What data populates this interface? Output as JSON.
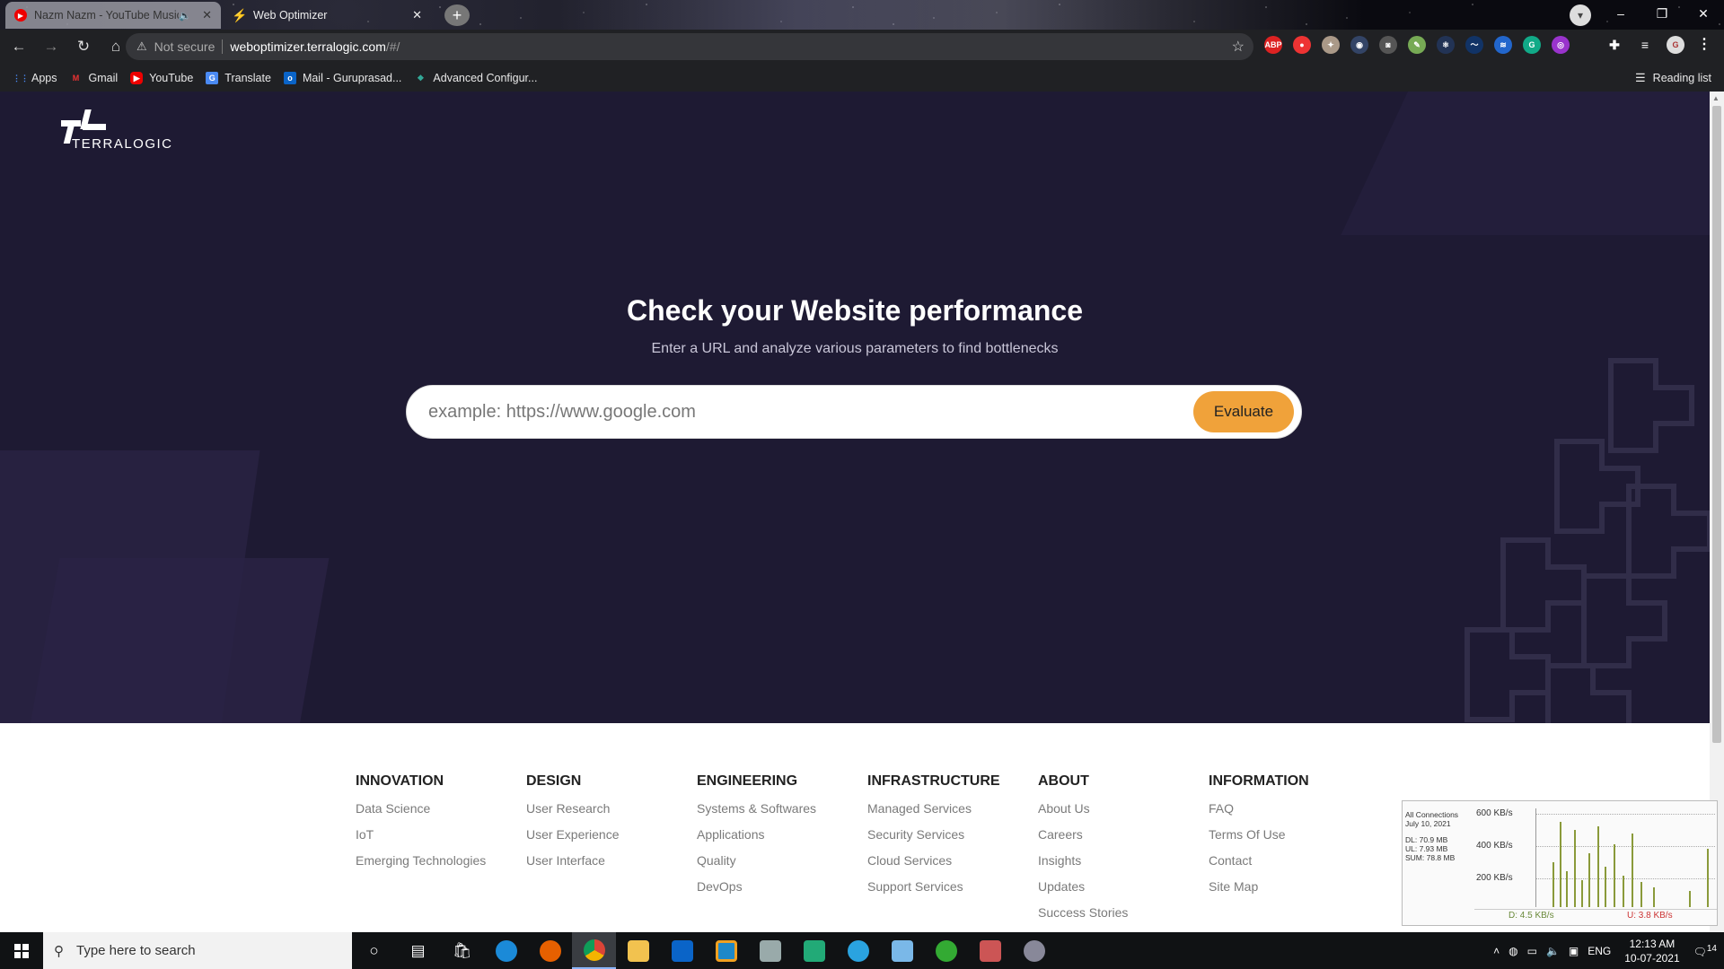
{
  "browser": {
    "tabs": [
      {
        "title": "Nazm Nazm - YouTube Music",
        "active": true
      },
      {
        "title": "Web Optimizer",
        "active": false
      }
    ],
    "omnibox": {
      "security": "Not secure",
      "host": "weboptimizer.terralogic.com",
      "path": "/#/"
    },
    "bookmarks": [
      {
        "label": "Apps"
      },
      {
        "label": "Gmail"
      },
      {
        "label": "YouTube"
      },
      {
        "label": "Translate"
      },
      {
        "label": "Mail - Guruprasad..."
      },
      {
        "label": "Advanced Configur..."
      }
    ],
    "reading_list": "Reading list",
    "extensions": [
      "ABP",
      "pocket",
      "puzzle",
      "camera",
      "pencil",
      "cube",
      "react",
      "wave",
      "stack",
      "G",
      "circle-purple"
    ]
  },
  "page": {
    "logo_text": "TERRALOGIC",
    "hero": {
      "title": "Check your Website performance",
      "subtitle": "Enter a URL and analyze various parameters to find bottlenecks",
      "search_placeholder": "example: https://www.google.com",
      "evaluate_label": "Evaluate"
    },
    "footer": [
      {
        "heading": "INNOVATION",
        "links": [
          "Data Science",
          "IoT",
          "Emerging Technologies"
        ]
      },
      {
        "heading": "DESIGN",
        "links": [
          "User Research",
          "User Experience",
          "User Interface"
        ]
      },
      {
        "heading": "ENGINEERING",
        "links": [
          "Systems & Softwares",
          "Applications",
          "Quality",
          "DevOps"
        ]
      },
      {
        "heading": "INFRASTRUCTURE",
        "links": [
          "Managed Services",
          "Security Services",
          "Cloud Services",
          "Support Services"
        ]
      },
      {
        "heading": "ABOUT",
        "links": [
          "About Us",
          "Careers",
          "Insights",
          "Updates",
          "Success Stories"
        ]
      },
      {
        "heading": "INFORMATION",
        "links": [
          "FAQ",
          "Terms Of Use",
          "Contact",
          "Site Map"
        ]
      }
    ]
  },
  "netmon": {
    "title": "All Connections",
    "date": "July 10, 2021",
    "dl": "DL: 70.9 MB",
    "ul": "UL: 7.93 MB",
    "sum": "SUM: 78.8 MB",
    "y_labels": [
      "600 KB/s",
      "400 KB/s",
      "200 KB/s"
    ],
    "down_rate": "D: 4.5 KB/s",
    "up_rate": "U: 3.8 KB/s"
  },
  "taskbar": {
    "search_placeholder": "Type here to search",
    "language": "ENG",
    "time": "12:13 AM",
    "date": "10-07-2021",
    "notifications": "14"
  },
  "colors": {
    "hero_bg": "#1e1a33",
    "accent": "#f0a23a"
  }
}
